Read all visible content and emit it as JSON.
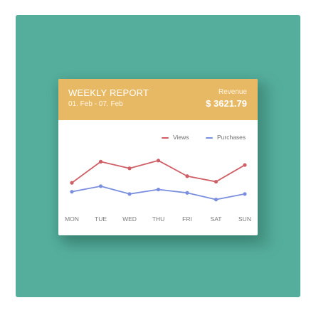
{
  "report": {
    "title": "WEEKLY REPORT",
    "dates": "01. Feb - 07. Feb",
    "revenue_label": "Revenue",
    "revenue_value": "$ 3621.79"
  },
  "colors": {
    "background": "#55ae9c",
    "header": "#e8b964",
    "views": "#cf5f66",
    "purchases": "#7b8fdf"
  },
  "chart_data": {
    "type": "line",
    "categories": [
      "MON",
      "TUE",
      "WED",
      "THU",
      "FRI",
      "SAT",
      "SUN"
    ],
    "series": [
      {
        "name": "Views",
        "color": "#cf5f66",
        "values": [
          58,
          77,
          71,
          78,
          64,
          59,
          74
        ]
      },
      {
        "name": "Purchases",
        "color": "#7b8fdf",
        "values": [
          50,
          55,
          48,
          52,
          49,
          43,
          48
        ]
      }
    ],
    "ylim": [
      30,
      90
    ],
    "legend": "top-right",
    "grid": false
  }
}
